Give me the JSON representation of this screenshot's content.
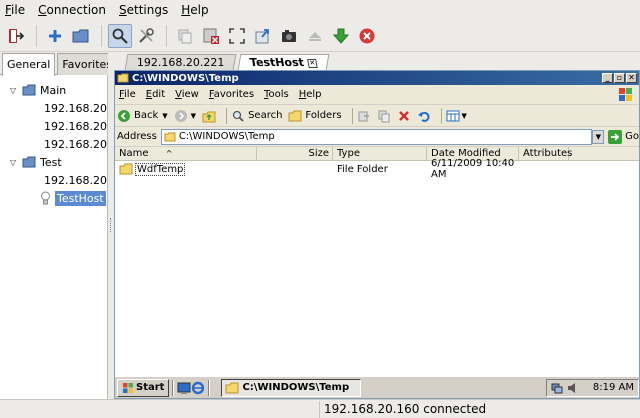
{
  "menubar": {
    "items": [
      {
        "first": "F",
        "rest": "ile"
      },
      {
        "first": "C",
        "rest": "onnection"
      },
      {
        "first": "S",
        "rest": "ettings"
      },
      {
        "first": "H",
        "rest": "elp"
      }
    ]
  },
  "toolbar": {
    "buttons": [
      "exit-icon",
      "add-icon",
      "folder-icon",
      "search-icon",
      "tools-icon",
      "copy-icon",
      "disconnect-icon",
      "fullscreen-icon",
      "send-file-icon",
      "screenshot-icon",
      "eject-icon",
      "download-icon",
      "stop-icon"
    ]
  },
  "left_panel": {
    "tabs": [
      "General",
      "Favorites"
    ],
    "tree": [
      {
        "label": "Main",
        "type": "group"
      },
      {
        "label": "192.168.20.",
        "type": "host"
      },
      {
        "label": "192.168.20.",
        "type": "host"
      },
      {
        "label": "192.168.20.",
        "type": "host"
      },
      {
        "label": "Test",
        "type": "group"
      },
      {
        "label": "192.168.20",
        "type": "host"
      },
      {
        "label": "TestHost",
        "type": "host-selected"
      }
    ]
  },
  "session_tabs": [
    {
      "label": "192.168.20.221"
    },
    {
      "label": "TestHost"
    }
  ],
  "remote": {
    "title": "C:\\WINDOWS\\Temp",
    "menu": [
      {
        "first": "F",
        "rest": "ile"
      },
      {
        "first": "E",
        "rest": "dit"
      },
      {
        "first": "V",
        "rest": "iew"
      },
      {
        "first": "F",
        "rest": "avorites"
      },
      {
        "first": "T",
        "rest": "ools"
      },
      {
        "first": "H",
        "rest": "elp"
      }
    ],
    "toolbar": {
      "back": "Back",
      "search": "Search",
      "folders": "Folders"
    },
    "address_label": "Address",
    "address_value": "C:\\WINDOWS\\Temp",
    "go_label": "Go",
    "columns": [
      "Name",
      "Size",
      "Type",
      "Date Modified",
      "Attributes"
    ],
    "sort_indicator": "^",
    "rows": [
      {
        "name": "WdfTemp",
        "size": "",
        "type": "File Folder",
        "date": "6/11/2009 10:40 AM",
        "attributes": ""
      }
    ],
    "taskbar": {
      "start": "Start",
      "task": "C:\\WINDOWS\\Temp",
      "clock": "8:19 AM"
    }
  },
  "status": {
    "text": "192.168.20.160 connected"
  }
}
